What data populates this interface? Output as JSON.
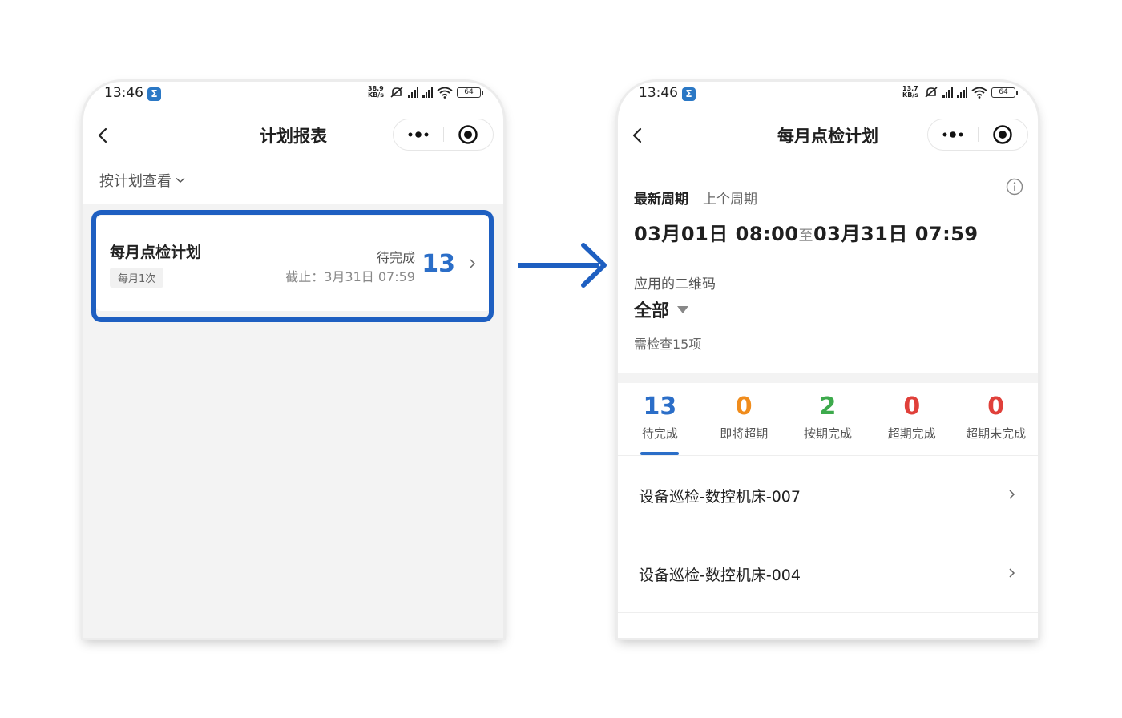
{
  "left_screen": {
    "status": {
      "time": "13:46",
      "badge": "Σ",
      "net_speed": "38.9 KB/s",
      "battery": "64"
    },
    "nav": {
      "title": "计划报表"
    },
    "filter": {
      "label": "按计划查看"
    },
    "plan": {
      "name": "每月点检计划",
      "frequency_tag": "每月1次",
      "status": "待完成",
      "deadline": "截止：3月31日 07:59",
      "pending_count": "13"
    }
  },
  "right_screen": {
    "status": {
      "time": "13:46",
      "badge": "Σ",
      "net_speed": "13.7 KB/s",
      "battery": "64"
    },
    "nav": {
      "title": "每月点检计划"
    },
    "cycle_tabs": {
      "active": "最新周期",
      "inactive": "上个周期"
    },
    "period": {
      "start": "03月01日 08:00",
      "separator": "至",
      "end": "03月31日 07:59"
    },
    "qr": {
      "label": "应用的二维码",
      "value": "全部"
    },
    "check_count": "需检查15项",
    "stats": [
      {
        "value": "13",
        "label": "待完成",
        "color": "#2b6ec8"
      },
      {
        "value": "0",
        "label": "即将超期",
        "color": "#f08c1c"
      },
      {
        "value": "2",
        "label": "按期完成",
        "color": "#3daa4c"
      },
      {
        "value": "0",
        "label": "超期完成",
        "color": "#e0403a"
      },
      {
        "value": "0",
        "label": "超期未完成",
        "color": "#e0403a"
      }
    ],
    "tasks": [
      {
        "name": "设备巡检-数控机床-007"
      },
      {
        "name": "设备巡检-数控机床-004"
      }
    ]
  },
  "colors": {
    "accent": "#2b6ec8",
    "highlight_border": "#1e5fc1",
    "arrow": "#1e5fc1"
  },
  "icons": [
    "back-chevron-icon",
    "more-dots-icon",
    "target-icon",
    "chevron-down-icon",
    "chevron-right-icon",
    "info-icon",
    "triangle-down-icon",
    "arrow-right-icon",
    "signal-icon",
    "wifi-icon",
    "mute-icon",
    "battery-icon"
  ]
}
